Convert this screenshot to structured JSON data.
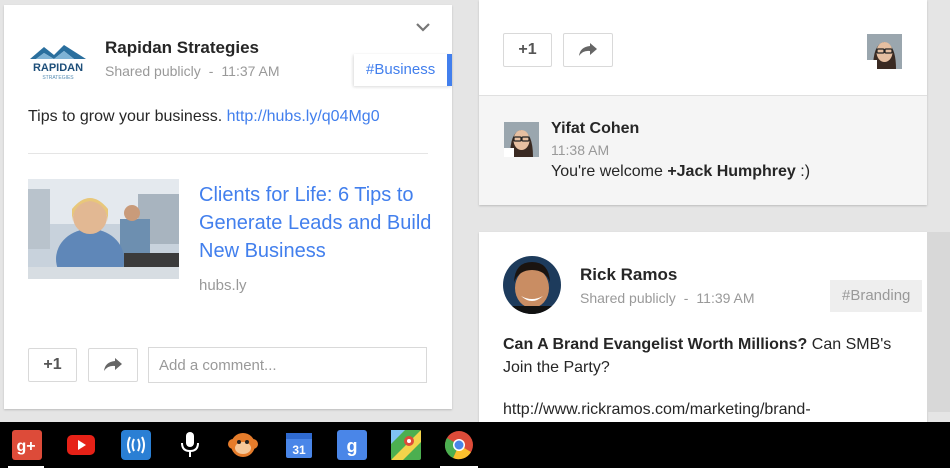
{
  "left_post": {
    "author": "Rapidan Strategies",
    "logo_text": "RAPIDAN",
    "logo_subtext": "STRATEGIES",
    "visibility": "Shared publicly",
    "separator": "-",
    "time": "11:37 AM",
    "hashtag": "#Business",
    "text": "Tips to grow your business.",
    "link": "http://hubs.ly/q04Mg0",
    "link_card": {
      "title": "Clients for Life: 6 Tips to Generate Leads and Build New Business",
      "domain": "hubs.ly"
    },
    "plus_one_label": "+1",
    "comment_placeholder": "Add a comment..."
  },
  "right_top_post": {
    "plus_one_label": "+1",
    "comment": {
      "author": "Yifat Cohen",
      "time": "11:38 AM",
      "text_prefix": "You're welcome ",
      "mention": "+Jack Humphrey",
      "text_suffix": " :)"
    }
  },
  "right_bottom_post": {
    "author": "Rick Ramos",
    "visibility": "Shared publicly",
    "separator": "-",
    "time": "11:39 AM",
    "hashtag": "#Branding",
    "bold_text": "Can A Brand Evangelist Worth Millions?",
    "text": " Can SMB's Join the Party?",
    "url": "http://www.rickramos.com/marketing/brand-"
  },
  "taskbar": {
    "apps": [
      {
        "name": "google-plus",
        "label": "g+",
        "color": "#dd4b39"
      },
      {
        "name": "youtube",
        "color": "#e62117"
      },
      {
        "name": "hangouts-wave",
        "color": "#2a7fd4"
      },
      {
        "name": "microphone",
        "color": "#ffffff"
      },
      {
        "name": "monkey",
        "color": "#e57c2b"
      },
      {
        "name": "calendar",
        "label": "31",
        "color": "#4a86e8"
      },
      {
        "name": "google-search",
        "label": "g",
        "color": "#4a86e8"
      },
      {
        "name": "maps",
        "color": "#4caf50"
      },
      {
        "name": "chrome",
        "color": "#dd4b39"
      }
    ]
  }
}
